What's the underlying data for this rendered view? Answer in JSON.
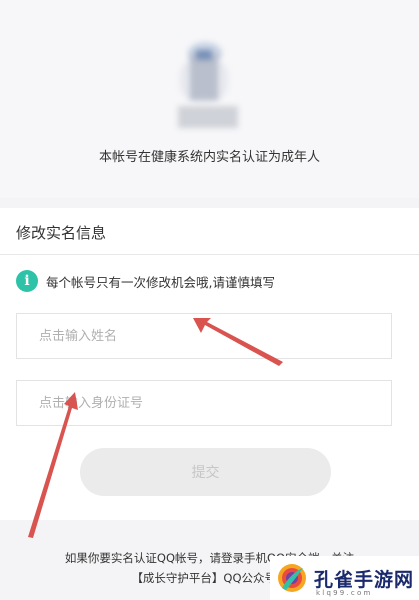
{
  "profile": {
    "status_text": "本帐号在健康系统内实名认证为成年人"
  },
  "form": {
    "title": "修改实名信息",
    "notice_icon": "i",
    "notice": "每个帐号只有一次修改机会哦,请谨慎填写",
    "name_placeholder": "点击输入姓名",
    "id_placeholder": "点击输入身份证号",
    "submit_label": "提交"
  },
  "footer": {
    "line1": "如果你要实名认证QQ帐号，请登录手机QQ安全端，关注",
    "line2": "【成长守护平台】QQ公众号进"
  },
  "watermark": {
    "name": "孔雀手游网",
    "url": "k l q 9 9 . c o m"
  },
  "colors": {
    "accent": "#2ec3a8",
    "arrow": "#d9534f"
  }
}
